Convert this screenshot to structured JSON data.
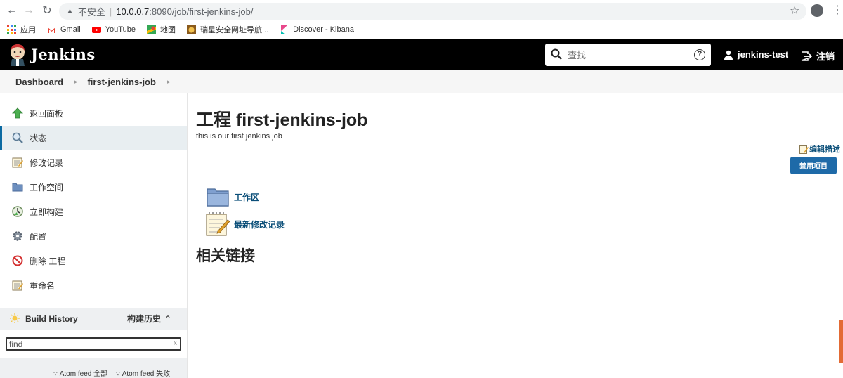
{
  "browser": {
    "url_warning": "不安全",
    "url_host": "10.0.0.7",
    "url_path": ":8090/job/first-jenkins-job/",
    "bookmarks": [
      {
        "label": "应用",
        "icon": "apps-grid-icon"
      },
      {
        "label": "Gmail",
        "icon": "gmail-icon"
      },
      {
        "label": "YouTube",
        "icon": "youtube-icon"
      },
      {
        "label": "地图",
        "icon": "maps-icon"
      },
      {
        "label": "瑞星安全网址导航...",
        "icon": "rising-icon"
      },
      {
        "label": "Discover - Kibana",
        "icon": "kibana-icon"
      }
    ]
  },
  "header": {
    "title": "Jenkins",
    "search_placeholder": "查找",
    "user": "jenkins-test",
    "logout": "注销"
  },
  "breadcrumb": [
    "Dashboard",
    "first-jenkins-job"
  ],
  "sidebar": {
    "tasks": [
      {
        "label": "返回面板",
        "icon": "up-arrow-icon"
      },
      {
        "label": "状态",
        "icon": "magnifier-icon",
        "active": true
      },
      {
        "label": "修改记录",
        "icon": "notepad-icon"
      },
      {
        "label": "工作空间",
        "icon": "folder-icon"
      },
      {
        "label": "立即构建",
        "icon": "build-clock-icon"
      },
      {
        "label": "配置",
        "icon": "gear-icon"
      },
      {
        "label": "删除 工程",
        "icon": "no-entry-icon"
      },
      {
        "label": "重命名",
        "icon": "notepad-icon"
      }
    ],
    "build_history": {
      "title": "Build History",
      "trend": "构建历史",
      "find_value": "find",
      "feed_all": "Atom feed 全部",
      "feed_failed": "Atom feed 失败"
    }
  },
  "main": {
    "title": "工程 first-jenkins-job",
    "description": "this is our first jenkins job",
    "edit_description": "编辑描述",
    "disable_button": "禁用项目",
    "links": [
      {
        "label": "工作区",
        "icon": "folder-icon"
      },
      {
        "label": "最新修改记录",
        "icon": "notepad-icon"
      }
    ],
    "related_links_heading": "相关链接"
  },
  "colors": {
    "header_bg": "#000000",
    "link": "#0b4f79",
    "button": "#1e6aa8"
  }
}
